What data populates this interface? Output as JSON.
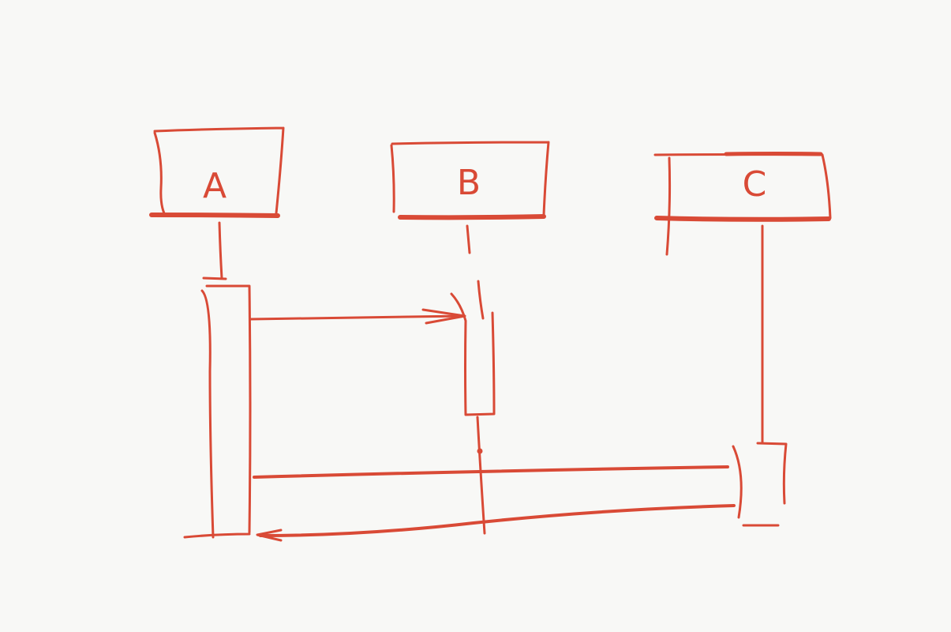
{
  "diagram": {
    "type": "sequence-diagram-sketch",
    "ink_color": "#d94a36",
    "background_color": "#f8f8f6",
    "participants": [
      {
        "id": "A",
        "label": "A"
      },
      {
        "id": "B",
        "label": "B"
      },
      {
        "id": "C",
        "label": "C"
      }
    ],
    "messages": [
      {
        "from": "A",
        "to": "B",
        "label": ""
      },
      {
        "from": "A",
        "to": "C",
        "label": ""
      },
      {
        "from": "C",
        "to": "A",
        "label": ""
      }
    ]
  }
}
